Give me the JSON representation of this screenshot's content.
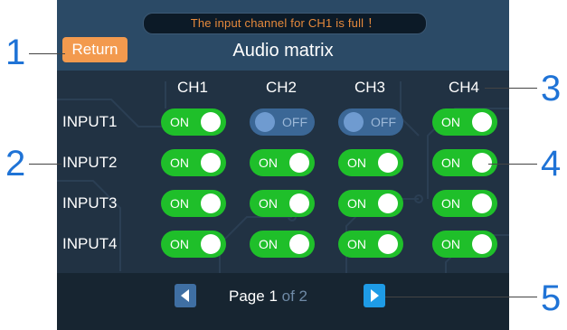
{
  "screen": {
    "notice": "The input channel for CH1 is full ！",
    "return_label": "Return",
    "title": "Audio matrix"
  },
  "matrix": {
    "columns": [
      "CH1",
      "CH2",
      "CH3",
      "CH4"
    ],
    "rows": [
      {
        "label": "INPUT1",
        "states": [
          "ON",
          "OFF",
          "OFF",
          "ON"
        ]
      },
      {
        "label": "INPUT2",
        "states": [
          "ON",
          "ON",
          "ON",
          "ON"
        ]
      },
      {
        "label": "INPUT3",
        "states": [
          "ON",
          "ON",
          "ON",
          "ON"
        ]
      },
      {
        "label": "INPUT4",
        "states": [
          "ON",
          "ON",
          "ON",
          "ON"
        ]
      }
    ]
  },
  "pagination": {
    "prefix": "Page",
    "current": "1",
    "total_text": "of 2"
  },
  "callouts": [
    "1",
    "2",
    "3",
    "4",
    "5"
  ],
  "colors": {
    "screen_bg": "#213243",
    "header_bg": "#2b4a66",
    "toggle_on": "#1fbf2a",
    "toggle_off": "#3b6796",
    "return_button": "#f39a4e",
    "notice_text": "#e78a3c",
    "callout": "#1f73d6",
    "nav_prev": "#3f6fa3",
    "nav_next": "#1e9be6"
  },
  "icons": {
    "prev": "triangle-left-icon",
    "next": "triangle-right-icon"
  }
}
